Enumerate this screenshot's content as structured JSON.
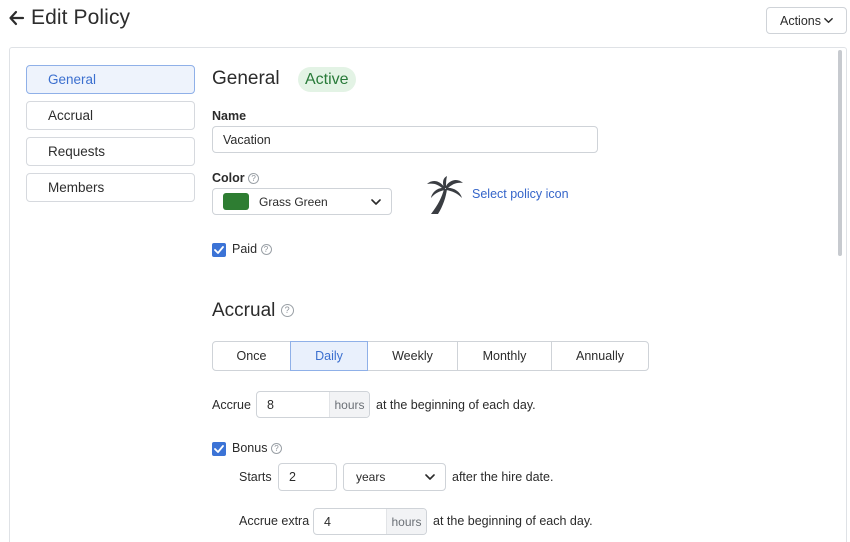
{
  "header": {
    "title": "Edit Policy",
    "actions_label": "Actions"
  },
  "sidebar": {
    "items": [
      {
        "label": "General",
        "active": true
      },
      {
        "label": "Accrual",
        "active": false
      },
      {
        "label": "Requests",
        "active": false
      },
      {
        "label": "Members",
        "active": false
      }
    ]
  },
  "general": {
    "title": "General",
    "status": "Active",
    "name_label": "Name",
    "name_value": "Vacation",
    "color_label": "Color",
    "color_value": "Grass Green",
    "color_hex": "#2e7d32",
    "icon": "palm-tree-icon",
    "select_icon_link": "Select policy icon",
    "paid_label": "Paid",
    "paid_checked": true
  },
  "accrual": {
    "title": "Accrual",
    "frequency_options": [
      "Once",
      "Daily",
      "Weekly",
      "Monthly",
      "Annually"
    ],
    "selected_frequency": "Daily",
    "accrue_label": "Accrue",
    "accrue_value": "8",
    "accrue_unit": "hours",
    "accrue_suffix": "at the beginning of each day.",
    "bonus_label": "Bonus",
    "bonus_checked": true,
    "starts_label": "Starts",
    "starts_value": "2",
    "starts_unit": "years",
    "starts_suffix": "after the hire date.",
    "extra_label": "Accrue extra",
    "extra_value": "4",
    "extra_unit": "hours",
    "extra_suffix": "at the beginning of each day."
  },
  "colors": {
    "accent": "#3b73d6",
    "active_badge_bg": "#e3f3e5",
    "active_badge_text": "#287a39"
  }
}
